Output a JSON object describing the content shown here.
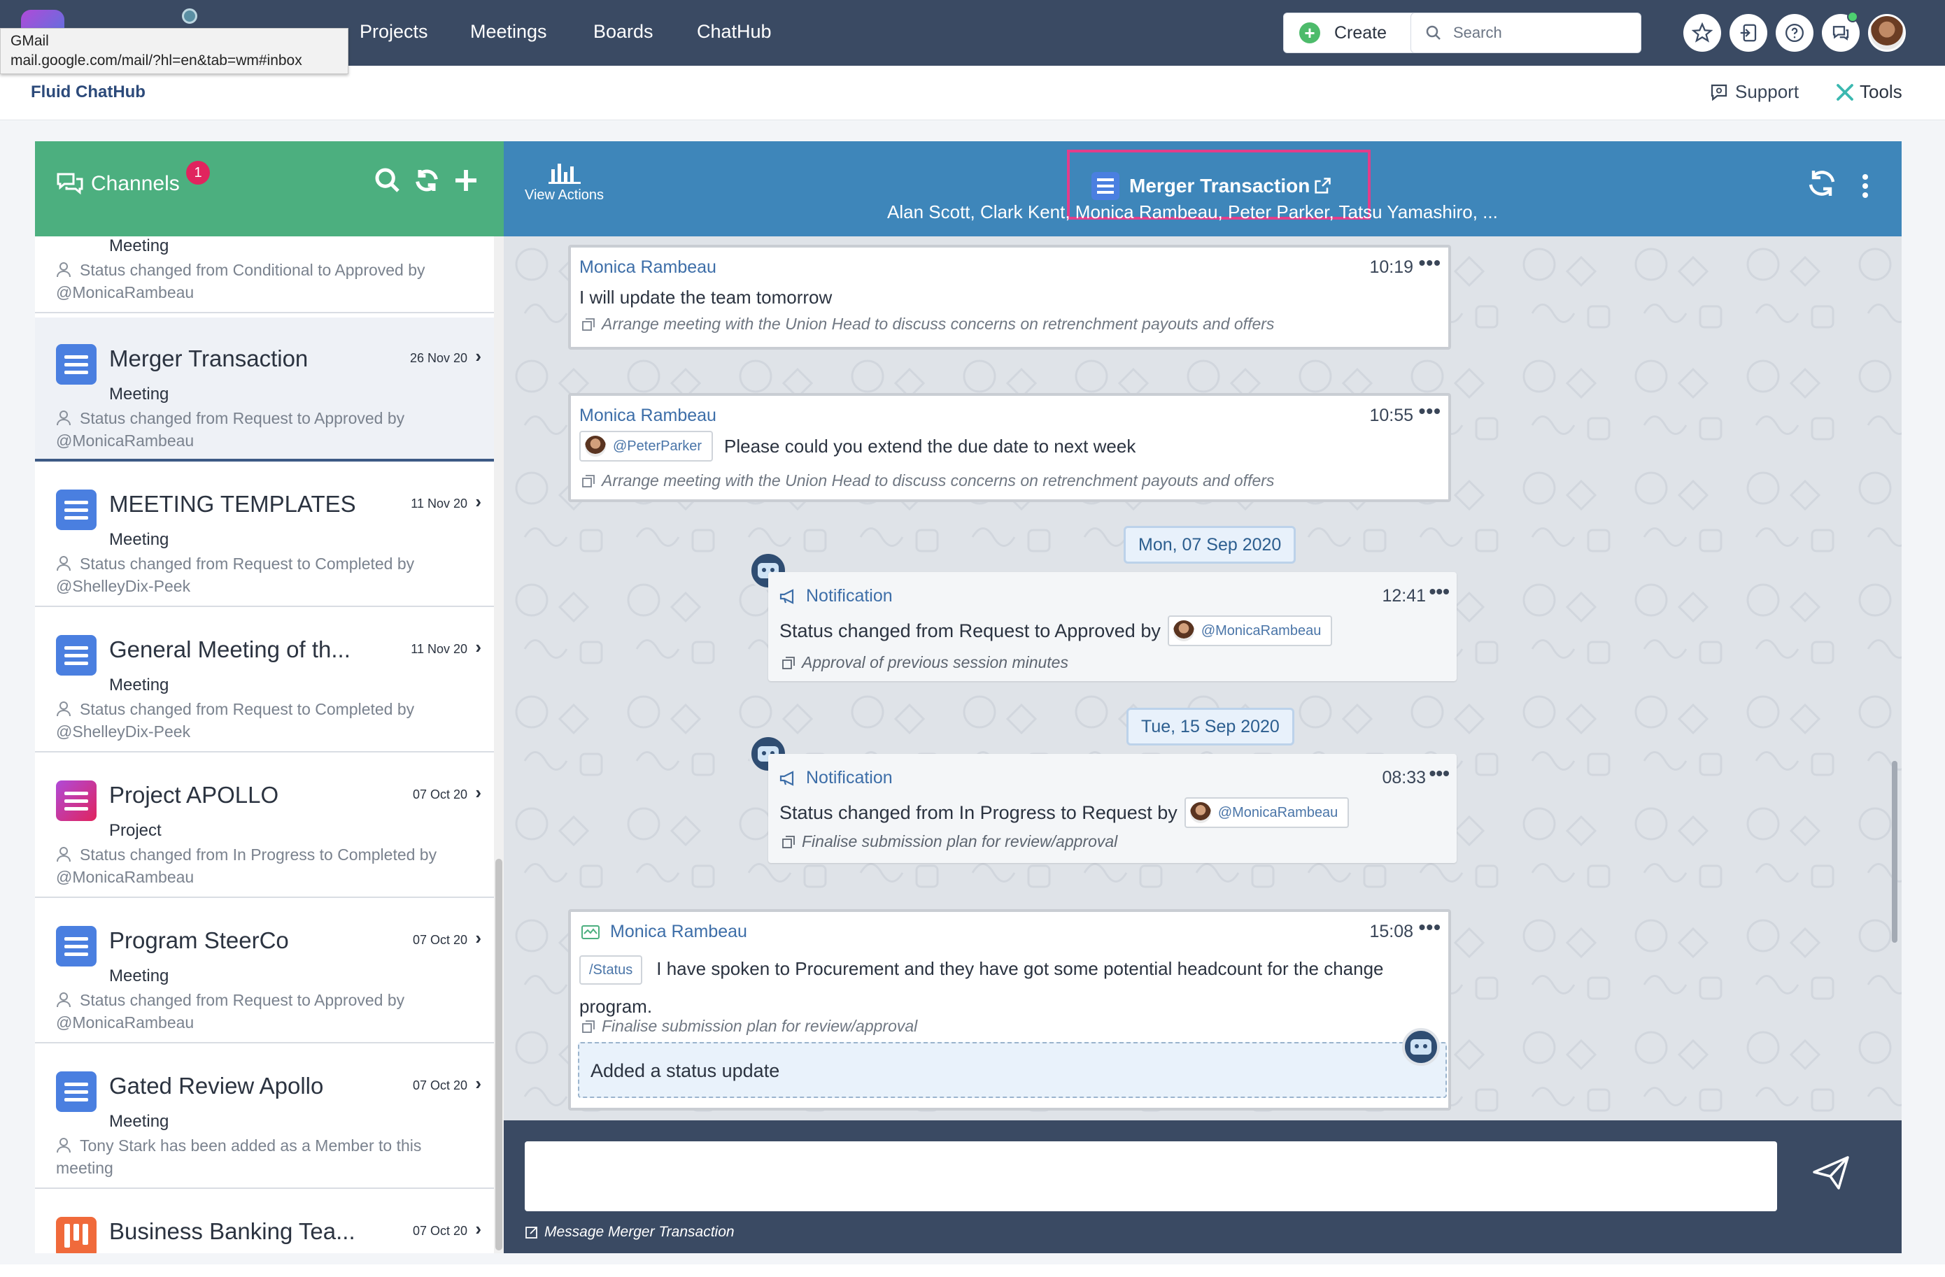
{
  "topnav": {
    "items": [
      "Projects",
      "Meetings",
      "Boards",
      "ChatHub"
    ],
    "create_label": "Create",
    "search_placeholder": "Search"
  },
  "tooltip": {
    "title": "GMail",
    "url": "mail.google.com/mail/?hl=en&tab=wm#inbox"
  },
  "subheader": {
    "brand": "Fluid ChatHub",
    "support_label": "Support",
    "tools_label": "Tools"
  },
  "channels": {
    "title": "Channels",
    "badge": "1",
    "items": [
      {
        "name": "",
        "date": "",
        "type": "Meeting",
        "status": "Status changed from Conditional to Approved by @MonicaRambeau",
        "color": "#4a7fe0"
      },
      {
        "name": "Merger Transaction",
        "date": "26 Nov 20",
        "type": "Meeting",
        "status": "Status changed from Request to Approved by @MonicaRambeau",
        "color": "#4a7fe0"
      },
      {
        "name": "MEETING TEMPLATES",
        "date": "11 Nov 20",
        "type": "Meeting",
        "status": "Status changed from Request to Completed by @ShelleyDix-Peek",
        "color": "#4a7fe0"
      },
      {
        "name": "General Meeting of th...",
        "date": "11 Nov 20",
        "type": "Meeting",
        "status": "Status changed from Request to Completed by @ShelleyDix-Peek",
        "color": "#4a7fe0"
      },
      {
        "name": "Project APOLLO",
        "date": "07 Oct 20",
        "type": "Project",
        "status": "Status changed from In Progress to Completed by @MonicaRambeau",
        "color": "#d6357a"
      },
      {
        "name": "Program SteerCo",
        "date": "07 Oct 20",
        "type": "Meeting",
        "status": "Status changed from Request to Approved by @MonicaRambeau",
        "color": "#4a7fe0"
      },
      {
        "name": "Gated Review Apollo",
        "date": "07 Oct 20",
        "type": "Meeting",
        "status": "Tony Stark has been added as a Member to this meeting",
        "color": "#4a7fe0"
      },
      {
        "name": "Business Banking Tea...",
        "date": "07 Oct 20",
        "type": "",
        "status": "",
        "color": "#f06a3b"
      }
    ]
  },
  "chat": {
    "view_actions_label": "View Actions",
    "title": "Merger Transaction",
    "members": "Alan Scott, Clark Kent, Monica Rambeau, Peter Parker, Tatsu Yamashiro, ...",
    "messages": [
      {
        "author": "Monica Rambeau",
        "time": "10:19",
        "text": "I will update the team tomorrow",
        "ref": "Arrange meeting with the Union Head to discuss concerns on retrenchment payouts and offers"
      },
      {
        "author": "Monica Rambeau",
        "time": "10:55",
        "mention": "@PeterParker",
        "text": "Please could you extend the due date to next week",
        "ref": "Arrange meeting with the Union Head to discuss concerns on retrenchment payouts and offers"
      },
      {
        "author": "Monica Rambeau",
        "time": "15:08",
        "tag": "/Status",
        "text": "I have spoken to Procurement and they have got some potential headcount for the change",
        "text2": "program.",
        "ref": "Finalise submission plan for review/approval",
        "added": "Added a status update"
      }
    ],
    "dates": [
      "Mon, 07 Sep 2020",
      "Tue, 15 Sep 2020"
    ],
    "notifications": [
      {
        "title": "Notification",
        "time": "12:41",
        "text": "Status changed from Request to Approved by",
        "mention": "@MonicaRambeau",
        "ref": "Approval of previous session minutes"
      },
      {
        "title": "Notification",
        "time": "08:33",
        "text": "Status changed from In Progress to Request by",
        "mention": "@MonicaRambeau",
        "ref": "Finalise submission plan for review/approval"
      }
    ],
    "composer_hint": "Message Merger Transaction"
  },
  "colors": {
    "topnav_bg": "#3a4a63",
    "channels_header": "#4caf7f",
    "chat_header": "#3e86ba",
    "highlight_box": "#e33d8a",
    "badge": "#e0245e"
  },
  "icons": [
    "search-icon",
    "refresh-icon",
    "plus-icon",
    "chat-bubbles-icon",
    "bar-chart-icon",
    "kebab-menu-icon",
    "external-link-icon",
    "send-icon",
    "megaphone-icon",
    "bot-icon",
    "star-icon",
    "help-icon"
  ]
}
